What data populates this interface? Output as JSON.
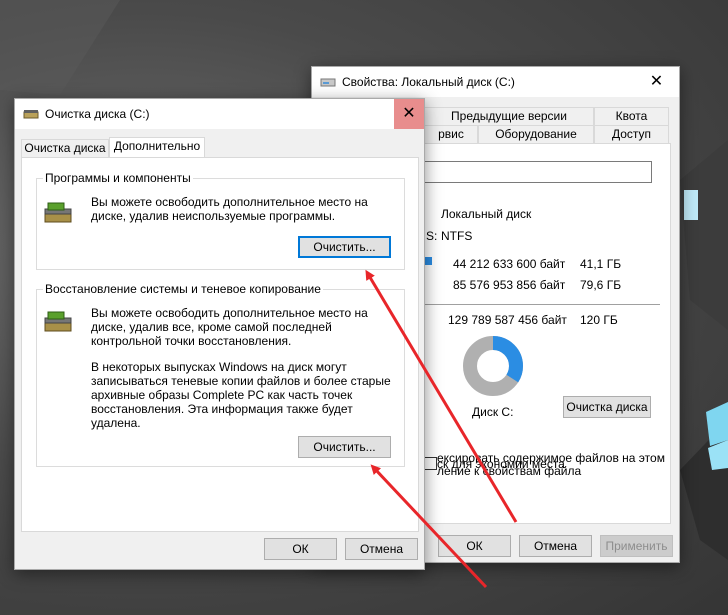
{
  "props_window": {
    "title": "Свойства: Локальный диск (C:)",
    "close_glyph": "✕",
    "tabs_row1": [
      "Предыдущие версии",
      "Квота"
    ],
    "tabs_row2": [
      "рвис",
      "Оборудование",
      "Доступ"
    ],
    "type_value": "Локальный диск",
    "fs_label": "S:",
    "fs_value": "NTFS",
    "used_bytes": "44 212 633 600 байт",
    "used_gb": "41,1 ГБ",
    "free_bytes": "85 576 953 856 байт",
    "free_gb": "79,6 ГБ",
    "total_bytes": "129 789 587 456 байт",
    "total_gb": "120 ГБ",
    "disk_label": "Диск C:",
    "cleanup_button": "Очистка диска",
    "compress_text": "ск для экономии места",
    "index_line1": "ексировать содержимое файлов на этом",
    "index_line2": "ление к свойствам файла",
    "ok": "ОК",
    "cancel": "Отмена",
    "apply": "Применить",
    "used_fraction": 0.341
  },
  "cleanup_window": {
    "title": "Очистка диска  (C:)",
    "close_glyph": "✕",
    "tabs": [
      "Очистка диска",
      "Дополнительно"
    ],
    "group1": {
      "title": "Программы и компоненты",
      "text": "Вы можете освободить дополнительное место на диске, удалив неиспользуемые программы.",
      "button": "Очистить..."
    },
    "group2": {
      "title": "Восстановление системы и теневое копирование",
      "text1": "Вы можете освободить дополнительное место на диске, удалив все, кроме самой последней контрольной точки восстановления.",
      "text2": "В некоторых выпусках Windows на диск могут записываться теневые копии файлов и более старые архивные образы Complete PC как часть точек восстановления. Эта информация также будет удалена.",
      "button": "Очистить..."
    },
    "ok": "ОК",
    "cancel": "Отмена"
  },
  "colors": {
    "used": "#2b8de3",
    "free": "#b0b0b0",
    "arrow": "#e8262a",
    "close_hover": "#e81123"
  }
}
